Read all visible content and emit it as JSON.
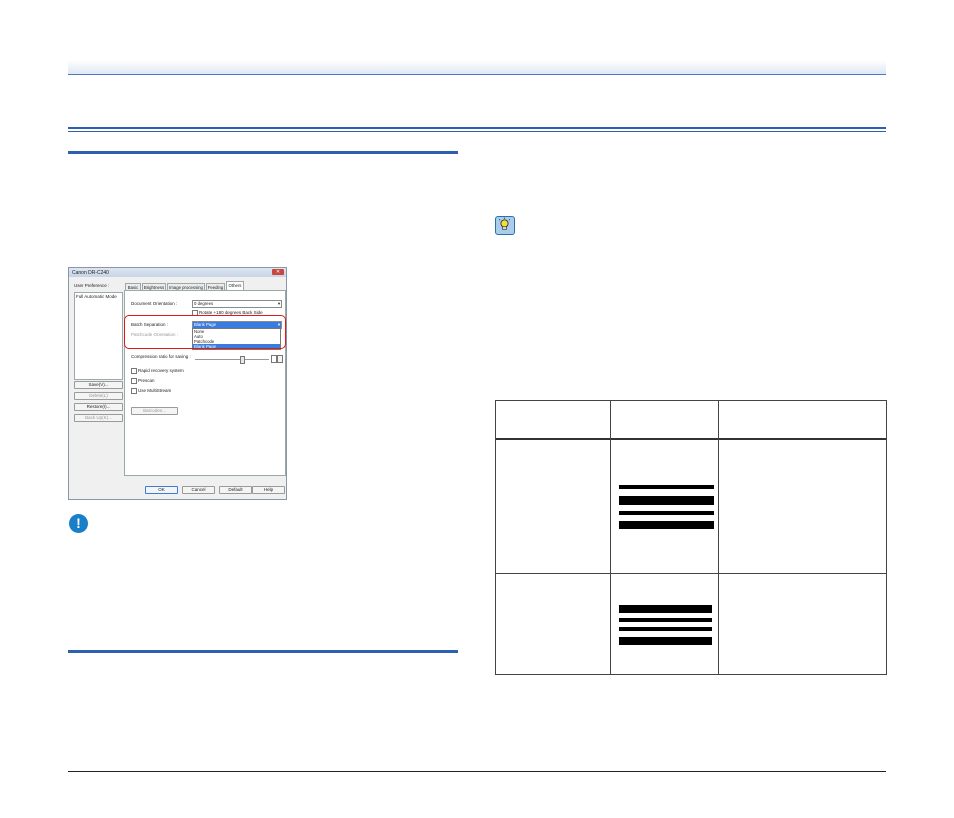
{
  "dialog": {
    "title": "Canon DR-C240",
    "user_preference_label": "User Preference :",
    "preference_list": [
      "Full Automatic Mode"
    ],
    "side_buttons": [
      "Save(V)...",
      "Delete(L)",
      "Restore(I)...",
      "Back Up(K)..."
    ],
    "tabs": [
      "Basic",
      "Brightness",
      "Image processing",
      "Feeding",
      "Others"
    ],
    "document_orientation_label": "Document Orientation :",
    "document_orientation_value": "0 degrees",
    "rotate_label": "Rotate +180 degrees Back Side",
    "batch_separation_label": "Batch Separation :",
    "batch_separation_value": "Blank Page",
    "batch_options": [
      "None",
      "Auto",
      "Patchcode",
      "Blank Page"
    ],
    "patchcode_orientation_label": "Patchcode Orientation :",
    "compression_label": "Compression ratio for saving :",
    "checkboxes": [
      "Rapid recovery system",
      "Prescan",
      "Use MultiStream"
    ],
    "barcodes_button": "Barcodes...",
    "footer_buttons": [
      "OK",
      "Cancel",
      "Default",
      "Help"
    ]
  },
  "colors": {
    "accent_rule": "#2e5fb0",
    "highlight_box": "#e01818",
    "warning_icon": "#1a7fc9",
    "hint_icon": "#a9cdeb"
  },
  "icons": {
    "warning": "exclamation-icon",
    "hint": "lightbulb-icon"
  }
}
